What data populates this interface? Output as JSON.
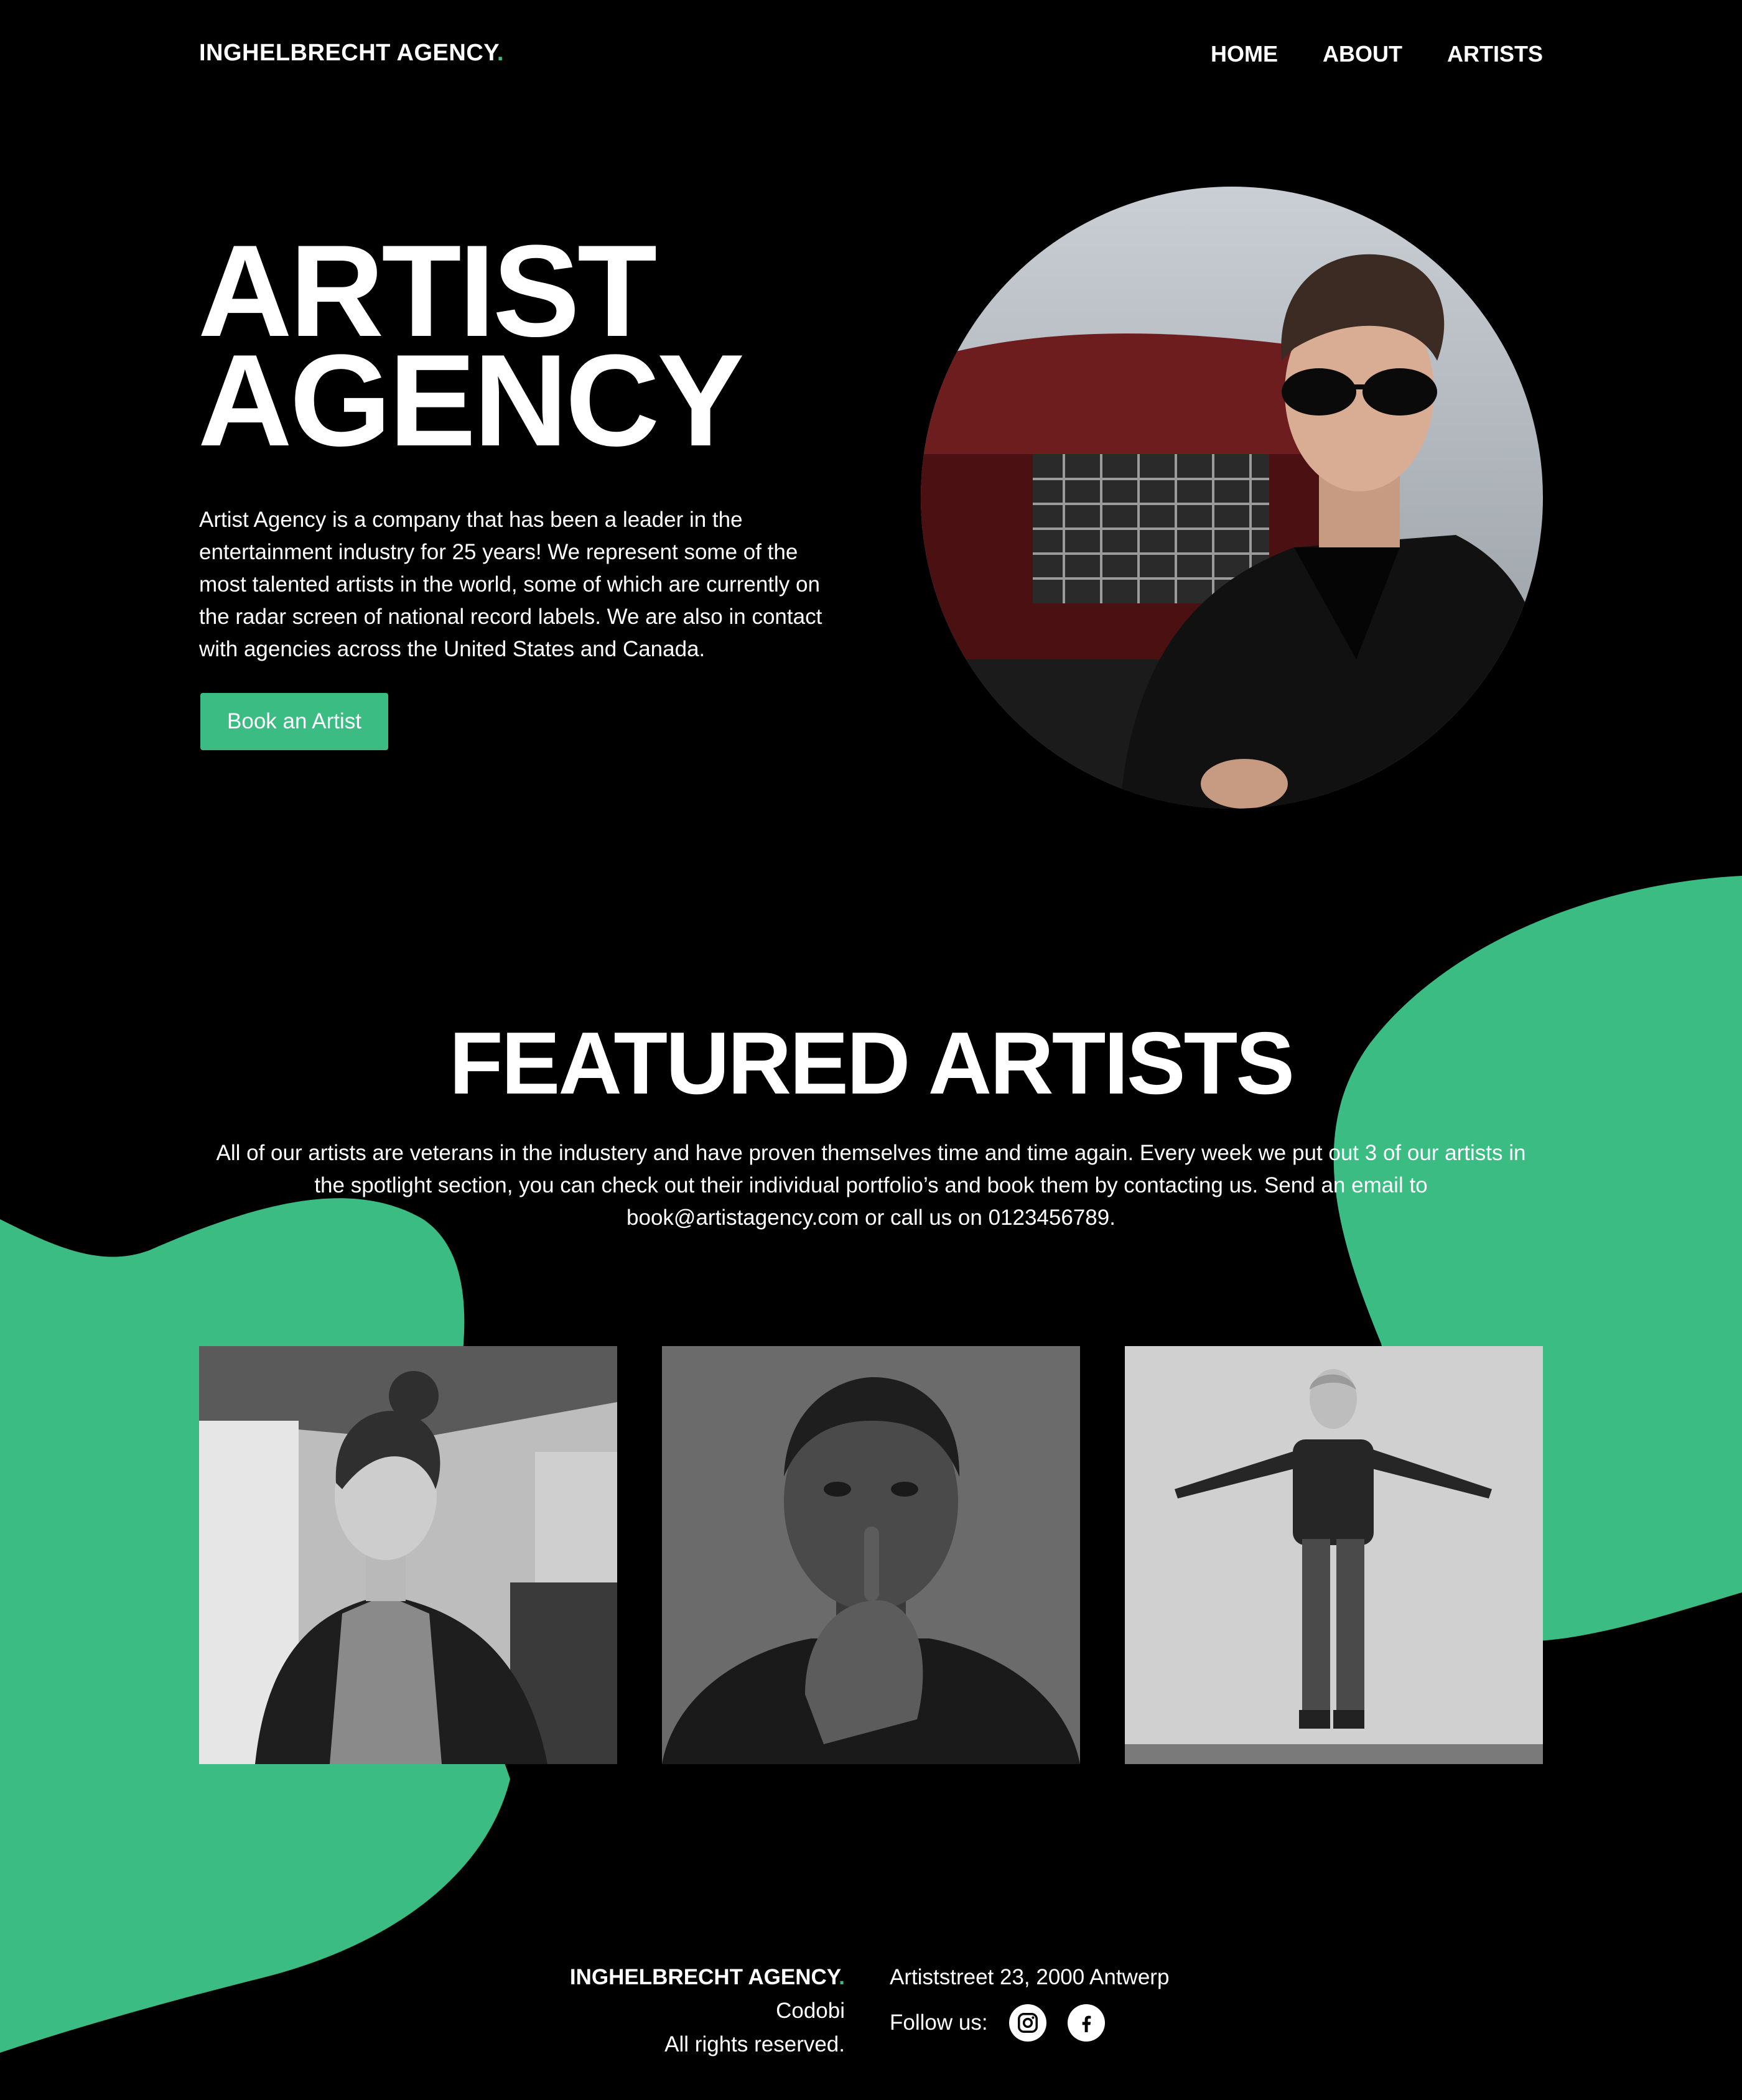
{
  "colors": {
    "accent": "#3bbc82",
    "background": "#000000",
    "text": "#ffffff"
  },
  "header": {
    "logo_text": "INGHELBRECHT AGENCY",
    "logo_dot": ".",
    "nav": [
      {
        "label": "HOME"
      },
      {
        "label": "ABOUT"
      },
      {
        "label": "ARTISTS"
      }
    ]
  },
  "hero": {
    "title_line1": "ARTIST",
    "title_line2": "AGENCY",
    "description": "Artist Agency is a company that has been a leader in the entertainment industry for 25 years! We represent some of the most talented artists in the world, some of which are currently on the radar screen of national record labels. We are also in contact with agencies across the United States and Canada.",
    "cta_label": "Book an Artist"
  },
  "featured": {
    "title": "FEATURED ARTISTS",
    "description": "All of our artists are veterans in the industery and have proven themselves time and time again. Every week we put out 3 of our artists in the spotlight section, you can check out their individual portfolio’s and book them by contacting us. Send an email to book@artistagency.com or call us on 0123456789."
  },
  "footer": {
    "brand": "INGHELBRECHT AGENCY",
    "brand_dot": ".",
    "company": "Codobi",
    "rights": "All rights reserved.",
    "address": "Artiststreet 23, 2000 Antwerp",
    "follow_label": "Follow us:",
    "social_icons": [
      "instagram-icon",
      "facebook-icon"
    ]
  }
}
